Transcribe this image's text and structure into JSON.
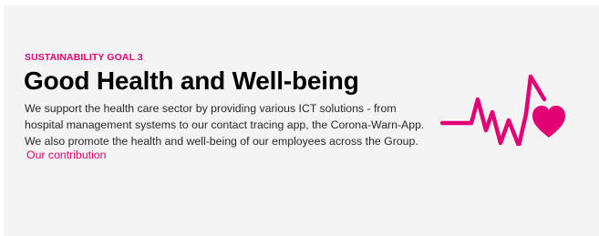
{
  "section": {
    "eyebrow": "SUSTAINABILITY GOAL 3",
    "title": "Good Health and Well-being",
    "description_lines": [
      "We support the health care sector by providing various ICT solutions - from",
      "hospital management systems to our contact tracing app, the Corona-Warn-App.",
      "We also promote the health and well-being of our employees across the Group."
    ],
    "link_label": "Our contribution"
  },
  "icon": {
    "name": "heartbeat-heart-icon",
    "color": "#e20074"
  },
  "colors": {
    "brand": "#e20074",
    "card_background": "#f4f4f4",
    "heading": "#000000",
    "body_text": "#262626"
  }
}
